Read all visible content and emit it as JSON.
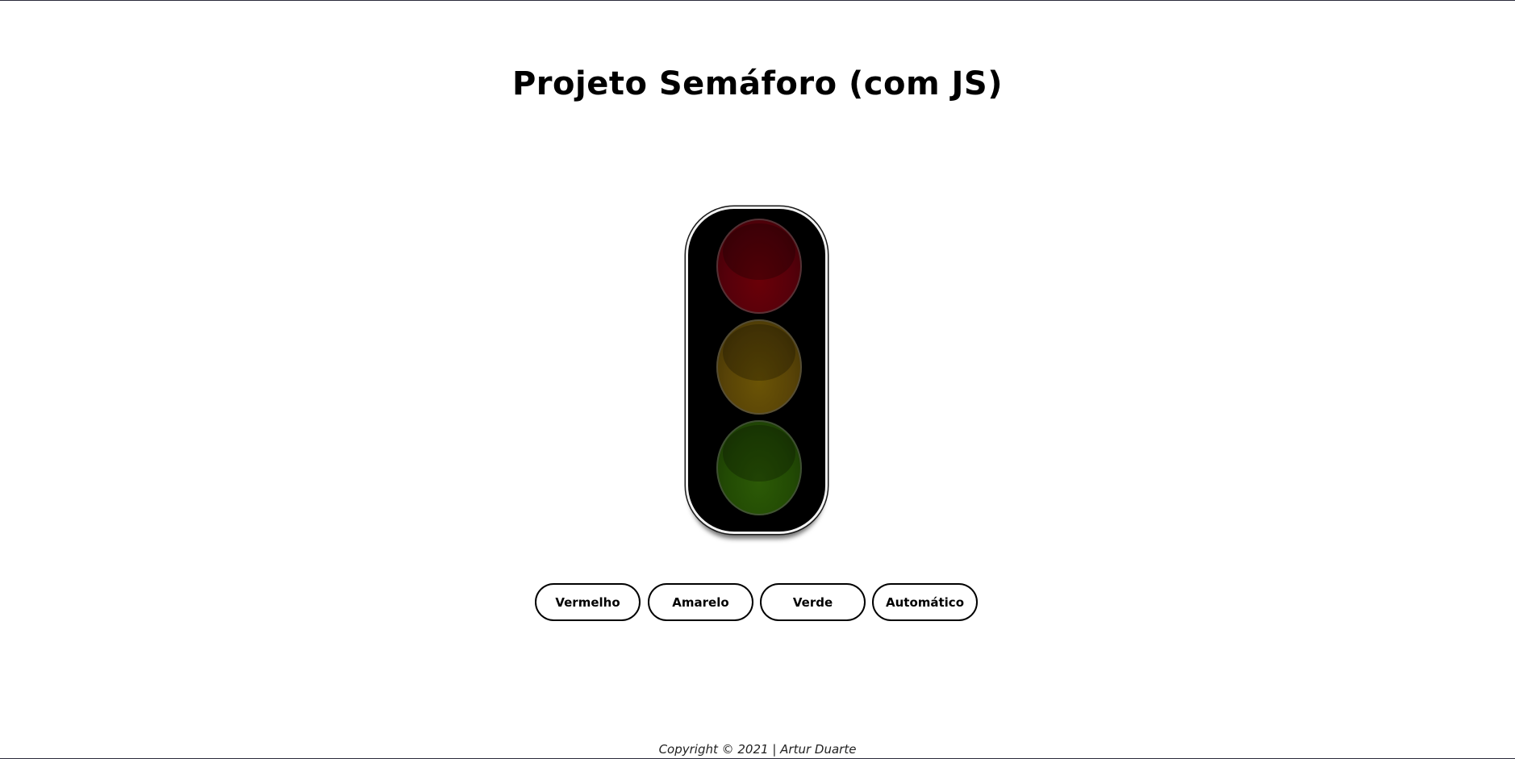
{
  "page": {
    "title": "Projeto Semáforo (com JS)"
  },
  "traffic_light": {
    "lamps": [
      {
        "name": "red",
        "color": "#55000a",
        "state": "off"
      },
      {
        "name": "yellow",
        "color": "#584307",
        "state": "off"
      },
      {
        "name": "green",
        "color": "#224a04",
        "state": "off"
      }
    ]
  },
  "buttons": {
    "red_label": "Vermelho",
    "yellow_label": "Amarelo",
    "green_label": "Verde",
    "auto_label": "Automático"
  },
  "footer": {
    "text": "Copyright © 2021 | Artur Duarte"
  }
}
